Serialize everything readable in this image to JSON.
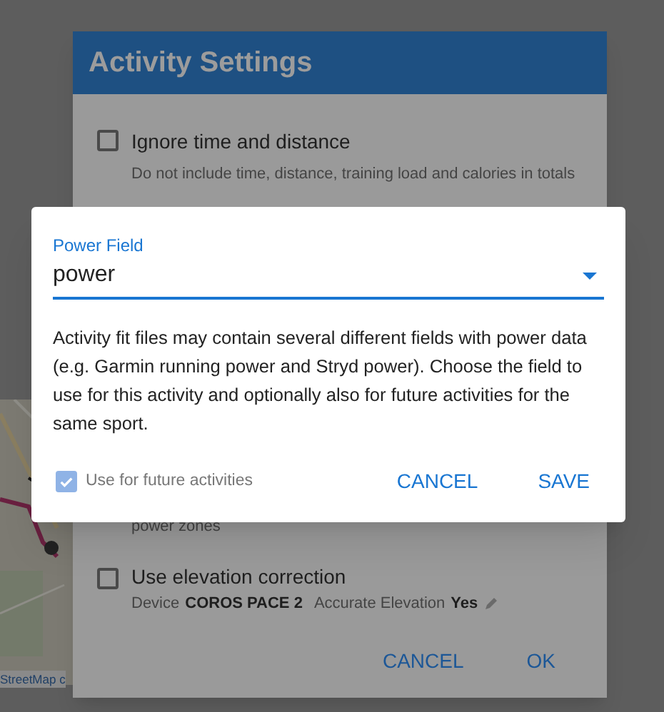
{
  "map": {
    "kind": "picture",
    "attribution": "StreetMap c"
  },
  "background_dialog": {
    "title": "Activity Settings",
    "options": [
      {
        "label": "Ignore time and distance",
        "description": "Do not include time, distance, training load and calories in totals",
        "checked": false
      }
    ],
    "partial_description": "power zones",
    "elevation": {
      "label": "Use elevation correction",
      "checked": false,
      "device_label": "Device",
      "device": "COROS PACE 2",
      "accuracy_label": "Accurate Elevation",
      "accuracy": "Yes"
    },
    "buttons": [
      "CANCEL",
      "OK"
    ]
  },
  "power_dialog": {
    "field": {
      "label": "Power Field",
      "value": "power"
    },
    "description": "Activity fit files may contain several different fields with power data (e.g. Garmin running power and Stryd power). Choose the field to use for this activity and optionally also for future activities for the same sport.",
    "future": {
      "label": "Use for future activities",
      "checked": true
    },
    "buttons": [
      "CANCEL",
      "SAVE"
    ]
  }
}
